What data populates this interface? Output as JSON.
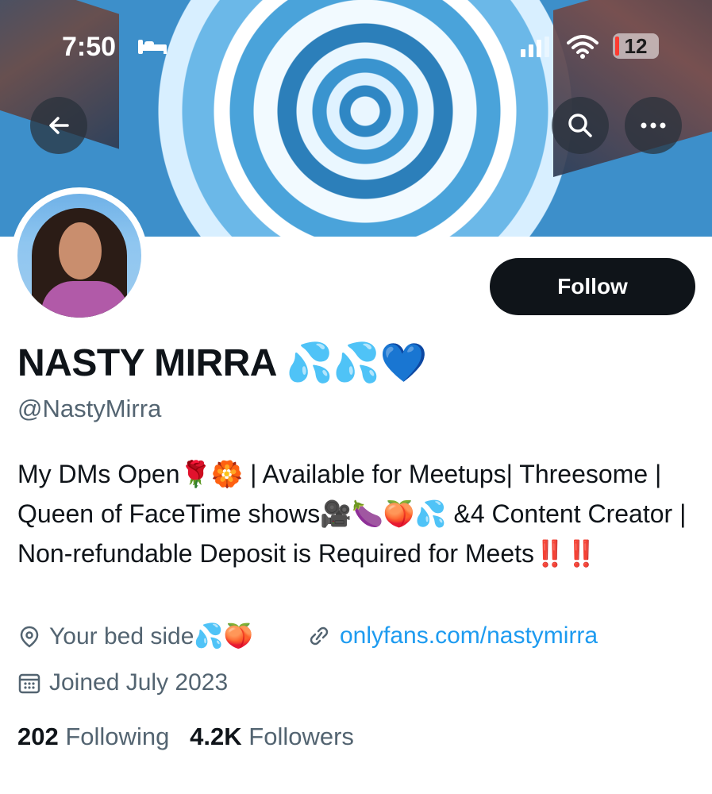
{
  "status_bar": {
    "time": "7:50",
    "battery": "12"
  },
  "profile": {
    "name": "NASTY MIRRA 💦💦💙",
    "handle": "@NastyMirra",
    "bio": "My DMs Open🌹🏵️ | Available for Meetups| Threesome | Queen of FaceTime shows🎥🍆🍑💦 &4 Content Creator | Non-refundable Deposit is Required for Meets‼️‼️",
    "location": "Your bed side💦🍑",
    "link": "onlyfans.com/nastymirra",
    "joined": "Joined July 2023",
    "following_count": "202",
    "following_label": "Following",
    "followers_count": "4.2K",
    "followers_label": "Followers"
  },
  "actions": {
    "follow_label": "Follow"
  },
  "icons": {
    "back": "arrow-left-icon",
    "search": "search-icon",
    "more": "more-dots-icon",
    "location": "location-pin-icon",
    "link": "link-icon",
    "calendar": "calendar-icon"
  },
  "colors": {
    "link": "#1d9bf0",
    "muted": "#536471",
    "text": "#0f1419",
    "follow_bg": "#0f1419"
  }
}
